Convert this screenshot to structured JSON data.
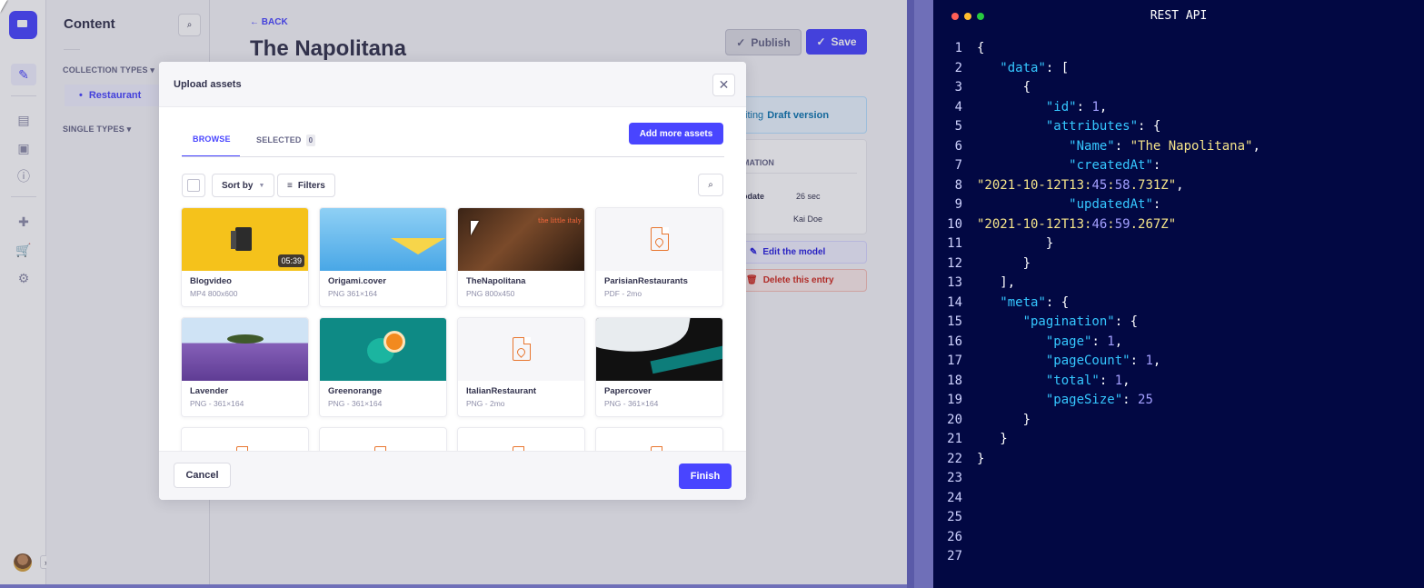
{
  "cms": {
    "subnav": {
      "title": "Content",
      "collection_types": "COLLECTION TYPES",
      "active_item": "Restaurant",
      "single_types": "SINGLE TYPES"
    },
    "page": {
      "back": "BACK",
      "title": "The Napolitana",
      "publish": "Publish",
      "save": "Save",
      "draft_prefix": "iting",
      "draft_bold": "Draft version",
      "info_title": "MATION",
      "info_key": "odate",
      "info_val": "26 sec",
      "info_author": "Kai Doe",
      "edit_model": "Edit the model",
      "delete_entry": "Delete this entry"
    }
  },
  "modal": {
    "title": "Upload assets",
    "tabs": {
      "browse": "BROWSE",
      "selected": "SELECTED",
      "selected_count": "0"
    },
    "add_more": "Add more assets",
    "sort_by": "Sort by",
    "filters": "Filters",
    "assets": [
      {
        "name": "Blogvideo",
        "meta": "MP4  800x600",
        "kind": "video",
        "duration": "05:39"
      },
      {
        "name": "Origami.cover",
        "meta": "PNG  361×164",
        "kind": "origami"
      },
      {
        "name": "TheNapolitana",
        "meta": "PNG  800x450",
        "kind": "restaurant"
      },
      {
        "name": "ParisianRestaurants",
        "meta": "PDF - 2mo",
        "kind": "pdf"
      },
      {
        "name": "Lavender",
        "meta": "PNG - 361×164",
        "kind": "lavender"
      },
      {
        "name": "Greenorange",
        "meta": "PNG - 361×164",
        "kind": "orange"
      },
      {
        "name": "ItalianRestaurant",
        "meta": "PNG - 2mo",
        "kind": "pdf"
      },
      {
        "name": "Papercover",
        "meta": "PNG - 361×164",
        "kind": "paper"
      }
    ],
    "cancel": "Cancel",
    "finish": "Finish"
  },
  "editor": {
    "title": "REST API",
    "lines": [
      "{",
      "   \"data\": [",
      "      {",
      "         \"id\": 1,",
      "         \"attributes\": {",
      "            \"Name\": \"The Napolitana\",",
      "            \"createdAt\":",
      "\"2021-10-12T13:45:58.731Z\",",
      "            \"updatedAt\":",
      "\"2021-10-12T13:46:59.267Z\"",
      "         }",
      "      }",
      "   ],",
      "   \"meta\": {",
      "      \"pagination\": {",
      "         \"page\": 1,",
      "         \"pageCount\": 1,",
      "         \"total\": 1,",
      "         \"pageSize\": 25",
      "      }",
      "   }",
      "}",
      "",
      "",
      "",
      "",
      ""
    ]
  },
  "colors": {
    "primary": "#4945ff",
    "editor_bg": "#020843",
    "json_key": "#35c7ff",
    "json_string": "#f5e48a",
    "json_number": "#a4a0ff"
  }
}
